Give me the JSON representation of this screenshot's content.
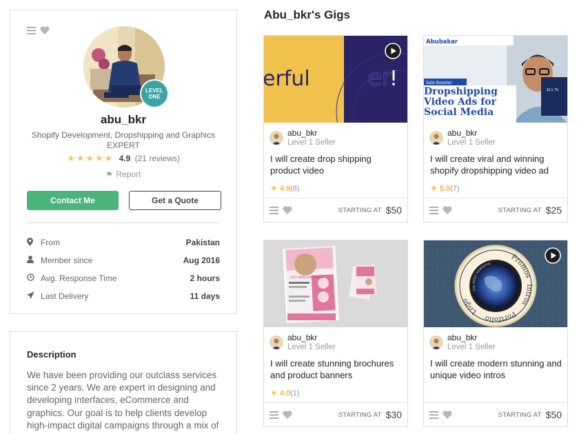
{
  "profile": {
    "username": "abu_bkr",
    "level_line1": "LEVEL",
    "level_line2": "ONE",
    "tagline": "Shopify Development, Dropshipping and Graphics EXPERT",
    "stars": "★★★★★",
    "rating": "4.9",
    "reviews": "(21 reviews)",
    "report": "Report",
    "contact_label": "Contact Me",
    "quote_label": "Get a Quote",
    "stats": [
      {
        "icon": "location-pin-icon",
        "label": "From",
        "value": "Pakistan"
      },
      {
        "icon": "user-icon",
        "label": "Member since",
        "value": "Aug 2016"
      },
      {
        "icon": "clock-icon",
        "label": "Avg. Response Time",
        "value": "2 hours"
      },
      {
        "icon": "paper-plane-icon",
        "label": "Last Delivery",
        "value": "11 days"
      }
    ]
  },
  "description": {
    "title": "Description",
    "body": "We have been providing our outclass services since 2 years. We are expert in designing and developing interfaces, eCommerce and graphics. Our goal is to help clients develop high-impact digital campaigns through a mix of"
  },
  "gigs_title": "Abu_bkr's Gigs",
  "gigs": [
    {
      "thumb_text": "erful",
      "seller": "abu_bkr",
      "level": "Level 1 Seller",
      "title": "I will create drop shipping product video",
      "stars": "★",
      "rating": "4.9",
      "count": "(8)",
      "starting": "STARTING AT",
      "price": "$50",
      "has_video": true
    },
    {
      "thumb_brand": "Abubakar",
      "thumb_tag": "Sale Booster",
      "thumb_heading": "Dropshipping Video Ads for Social Media",
      "thumb_stat": "$11.7k",
      "seller": "abu_bkr",
      "level": "Level 1 Seller",
      "title": "I will create viral and winning shopify dropshipping video ad",
      "stars": "★",
      "rating": "5.0",
      "count": "(7)",
      "starting": "STARTING AT",
      "price": "$25",
      "has_video": false
    },
    {
      "thumb_text": "2022 WORLD BUSINESS",
      "seller": "abu_bkr",
      "level": "Level 1 Seller",
      "title": "I will create stunning brochures and product banners",
      "stars": "★",
      "rating": "4.0",
      "count": "(1)",
      "starting": "STARTING AT",
      "price": "$30",
      "has_video": false
    },
    {
      "thumb_words": [
        "Promos",
        "Intros",
        "Portfolio",
        "Logo",
        "THE MOST POWERFUL"
      ],
      "seller": "abu_bkr",
      "level": "Level 1 Seller",
      "title": "I will create modern stunning and unique video intros",
      "starting": "STARTING AT",
      "price": "$50",
      "has_video": true
    }
  ],
  "colors": {
    "primary_green": "#4bb478",
    "star": "#ffbe5b",
    "level_badge": "#3aa3a4"
  }
}
